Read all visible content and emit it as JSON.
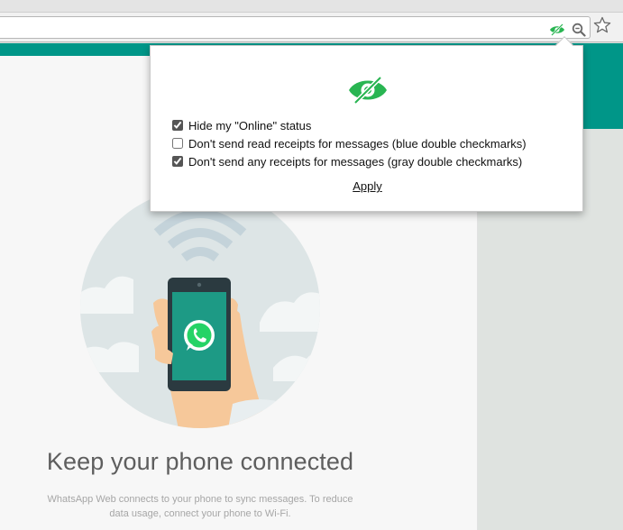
{
  "browser": {
    "icons": [
      "hide-eye-extension-icon",
      "zoom-icon",
      "bookmark-star-icon"
    ]
  },
  "popup": {
    "options": [
      {
        "label": "Hide my \"Online\" status",
        "checked": true
      },
      {
        "label": "Don't send read receipts for messages (blue double checkmarks)",
        "checked": false
      },
      {
        "label": "Don't send any receipts for messages (gray double checkmarks)",
        "checked": true
      }
    ],
    "apply_label": "Apply"
  },
  "page": {
    "headline": "Keep your phone connected",
    "subtext": "WhatsApp Web connects to your phone to sync messages. To reduce data usage, connect your phone to Wi-Fi."
  },
  "colors": {
    "brand_teal": "#009688",
    "whatsapp_green": "#25d366",
    "eye_green": "#29b552"
  }
}
